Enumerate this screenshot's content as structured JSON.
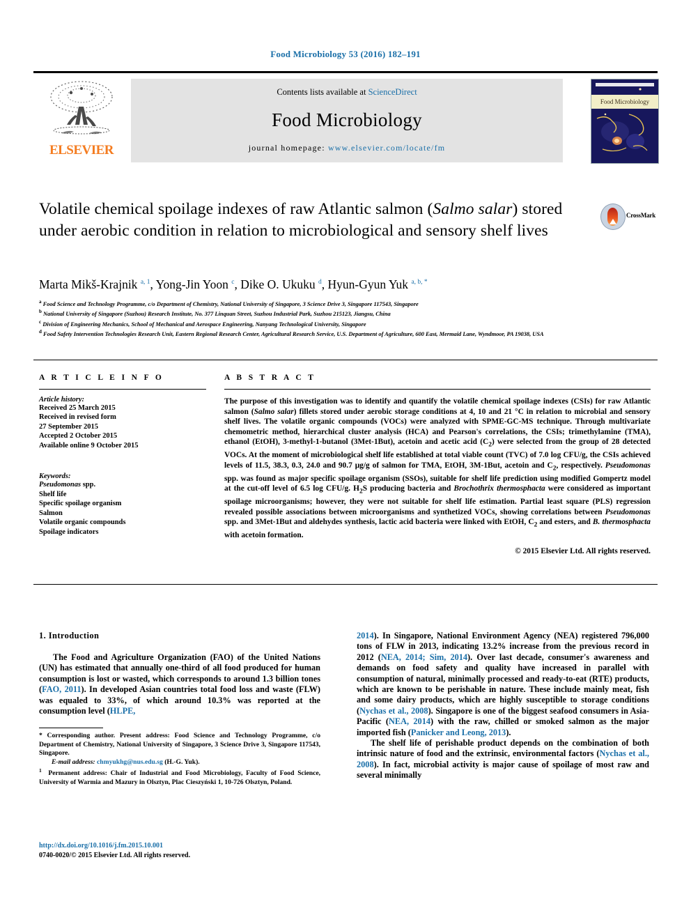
{
  "running_head": "Food Microbiology 53 (2016) 182–191",
  "masthead": {
    "contents_prefix": "Contents lists available at ",
    "sciencedirect": "ScienceDirect",
    "journal_title": "Food Microbiology",
    "homepage_label": "journal homepage: ",
    "homepage_url": "www.elsevier.com/locate/fm",
    "publisher": "ELSEVIER",
    "cover_title": "Food Microbiology",
    "accent_color": "#1a6fa8",
    "elsevier_orange": "#f47c20"
  },
  "article": {
    "title_part1": "Volatile chemical spoilage indexes of raw Atlantic salmon (",
    "title_italic1": "Salmo",
    "title_italic2": "salar",
    "title_part2": ") stored under aerobic condition in relation to microbiological and sensory shelf lives",
    "crossmark_label": "CrossMark"
  },
  "authors": [
    {
      "name": "Marta Mikš-Krajnik",
      "sup": "a, 1"
    },
    {
      "name": "Yong-Jin Yoon",
      "sup": "c"
    },
    {
      "name": "Dike O. Ukuku",
      "sup": "d"
    },
    {
      "name": "Hyun-Gyun Yuk",
      "sup": "a, b, *"
    }
  ],
  "affiliations": [
    {
      "label": "a",
      "text": "Food Science and Technology Programme, c/o Department of Chemistry, National University of Singapore, 3 Science Drive 3, Singapore 117543, Singapore"
    },
    {
      "label": "b",
      "text": "National University of Singapore (Suzhou) Research Institute, No. 377 Linquan Street, Suzhou Industrial Park, Suzhou 215123, Jiangsu, China"
    },
    {
      "label": "c",
      "text": "Division of Engineering Mechanics, School of Mechanical and Aerospace Engineering, Nanyang Technological University, Singapore"
    },
    {
      "label": "d",
      "text": "Food Safety Intervention Technologies Research Unit, Eastern Regional Research Center, Agricultural Research Service, U.S. Department of Agriculture, 600 East, Mermaid Lane, Wyndmoor, PA 19038, USA"
    }
  ],
  "article_info": {
    "heading": "A R T I C L E   I N F O",
    "history_label": "Article history:",
    "history": [
      "Received 25 March 2015",
      "Received in revised form",
      "27 September 2015",
      "Accepted 2 October 2015",
      "Available online 9 October 2015"
    ],
    "keywords_label": "Keywords:",
    "keywords": [
      "Pseudomonas spp.",
      "Shelf life",
      "Specific spoilage organism",
      "Salmon",
      "Volatile organic compounds",
      "Spoilage indicators"
    ]
  },
  "abstract": {
    "heading": "A B S T R A C T",
    "text": "The purpose of this investigation was to identify and quantify the volatile chemical spoilage indexes (CSIs) for raw Atlantic salmon (Salmo salar) fillets stored under aerobic storage conditions at 4, 10 and 21 °C in relation to microbial and sensory shelf lives. The volatile organic compounds (VOCs) were analyzed with SPME-GC-MS technique. Through multivariate chemometric method, hierarchical cluster analysis (HCA) and Pearson's correlations, the CSIs; trimethylamine (TMA), ethanol (EtOH), 3-methyl-1-butanol (3Met-1But), acetoin and acetic acid (C2) were selected from the group of 28 detected VOCs. At the moment of microbiological shelf life established at total viable count (TVC) of 7.0 log CFU/g, the CSIs achieved levels of 11.5, 38.3, 0.3, 24.0 and 90.7 μg/g of salmon for TMA, EtOH, 3M-1But, acetoin and C2, respectively. Pseudomonas spp. was found as major specific spoilage organism (SSOs), suitable for shelf life prediction using modified Gompertz model at the cut-off level of 6.5 log CFU/g. H2S producing bacteria and Brochothrix thermosphacta were considered as important spoilage microorganisms; however, they were not suitable for shelf life estimation. Partial least square (PLS) regression revealed possible associations between microorganisms and synthetized VOCs, showing correlations between Pseudomonas spp. and 3Met-1But and aldehydes synthesis, lactic acid bacteria were linked with EtOH, C2 and esters, and B. thermosphacta with acetoin formation.",
    "copyright": "© 2015 Elsevier Ltd. All rights reserved."
  },
  "introduction": {
    "heading": "1.  Introduction",
    "left_para": "The Food and Agriculture Organization (FAO) of the United Nations (UN) has estimated that annually one-third of all food produced for human consumption is lost or wasted, which corresponds to around 1.3 billion tones (FAO, 2011). In developed Asian countries total food loss and waste (FLW) was equaled to 33%, of which around 10.3% was reported at the consumption level (HLPE,",
    "right_para1": "2014). In Singapore, National Environment Agency (NEA) registered 796,000 tons of FLW in 2013, indicating 13.2% increase from the previous record in 2012 (NEA, 2014; Sim, 2014). Over last decade, consumer's awareness and demands on food safety and quality have increased in parallel with consumption of natural, minimally processed and ready-to-eat (RTE) products, which are known to be perishable in nature. These include mainly meat, fish and some dairy products, which are highly susceptible to storage conditions (Nychas et al., 2008). Singapore is one of the biggest seafood consumers in Asia-Pacific (NEA, 2014) with the raw, chilled or smoked salmon as the major imported fish (Panicker and Leong, 2013).",
    "right_para2": "The shelf life of perishable product depends on the combination of both intrinsic nature of food and the extrinsic, environmental factors (Nychas et al., 2008). In fact, microbial activity is major cause of spoilage of most raw and several minimally"
  },
  "footnotes": {
    "corresponding": "* Corresponding author. Present address: Food Science and Technology Programme, c/o Department of Chemistry, National University of Singapore, 3 Science Drive 3, Singapore 117543, Singapore.",
    "email_label": "E-mail address:",
    "email": "chmyukhg@nus.edu.sg",
    "email_owner": "(H.-G. Yuk).",
    "permanent": "1  Permanent address: Chair of Industrial and Food Microbiology, Faculty of Food Science, University of Warmia and Mazury in Olsztyn, Plac Cieszyński 1, 10-726 Olsztyn, Poland."
  },
  "footer": {
    "doi": "http://dx.doi.org/10.1016/j.fm.2015.10.001",
    "issn": "0740-0020/© 2015 Elsevier Ltd. All rights reserved."
  }
}
